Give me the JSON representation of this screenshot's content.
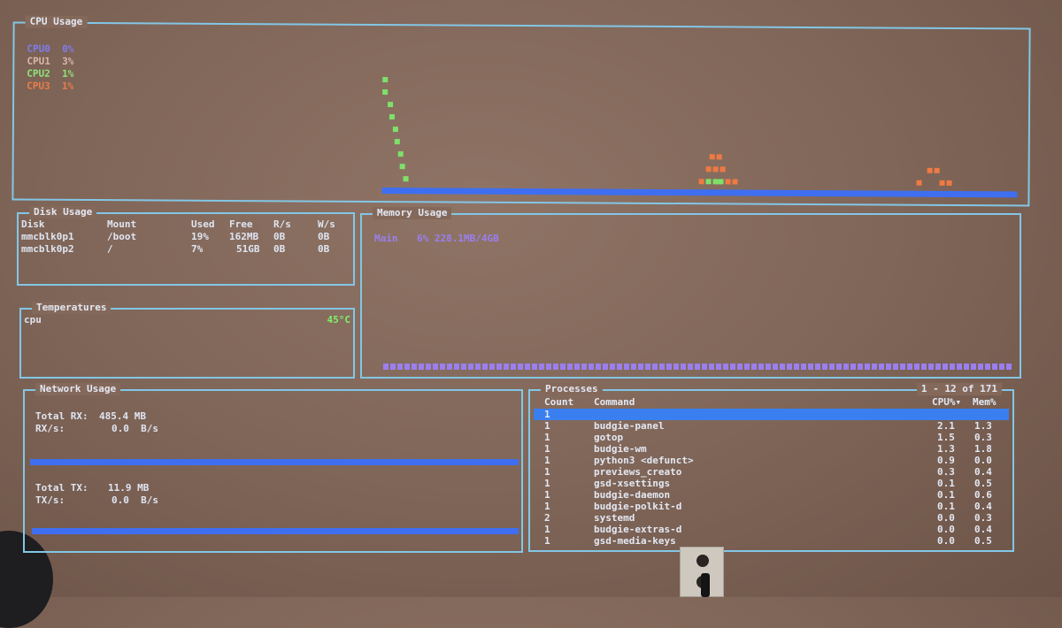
{
  "cpu": {
    "title": "CPU Usage",
    "legend": [
      {
        "name": "CPU0",
        "value": "0%",
        "color": "#7f7cf0"
      },
      {
        "name": "CPU1",
        "value": "3%",
        "color": "#d9b8a8"
      },
      {
        "name": "CPU2",
        "value": "1%",
        "color": "#8fe37a"
      },
      {
        "name": "CPU3",
        "value": "1%",
        "color": "#ea7c4b"
      }
    ],
    "colors": {
      "baseline": "#3f6ff0",
      "cpu2": "#7fe06a",
      "cpu3": "#ef7a43"
    }
  },
  "disk": {
    "title": "Disk Usage",
    "headers": [
      "Disk",
      "Mount",
      "Used",
      "Free",
      "R/s",
      "W/s"
    ],
    "rows": [
      [
        "mmcblk0p1",
        "/boot",
        "19%",
        "162MB",
        "0B",
        "0B"
      ],
      [
        "mmcblk0p2",
        "/",
        "7%",
        "51GB",
        "0B",
        "0B"
      ]
    ]
  },
  "memory": {
    "title": "Memory Usage",
    "label": "Main",
    "value": "6% 228.1MB/4GB",
    "color": "#9a7ff0"
  },
  "temps": {
    "title": "Temperatures",
    "sensor": "cpu",
    "value": "45°C",
    "value_color": "#7ff06a"
  },
  "network": {
    "title": "Network Usage",
    "rx_total_label": "Total RX:",
    "rx_total": "485.4 MB",
    "rx_rate_label": "RX/s:",
    "rx_rate": "0.0  B/s",
    "tx_total_label": "Total TX:",
    "tx_total": "11.9 MB",
    "tx_rate_label": "TX/s:",
    "tx_rate": "0.0  B/s"
  },
  "processes": {
    "title": "Processes",
    "range": "1 - 12 of 171",
    "headers": {
      "count": "Count",
      "command": "Command",
      "cpu": "CPU%▾",
      "mem": "Mem%"
    },
    "rows": [
      {
        "count": "1",
        "command": "",
        "cpu": "",
        "mem": "",
        "selected": true
      },
      {
        "count": "1",
        "command": "budgie-panel",
        "cpu": "2.1",
        "mem": "1.3"
      },
      {
        "count": "1",
        "command": "gotop",
        "cpu": "1.5",
        "mem": "0.3"
      },
      {
        "count": "1",
        "command": "budgie-wm",
        "cpu": "1.3",
        "mem": "1.8"
      },
      {
        "count": "1",
        "command": "python3 <defunct>",
        "cpu": "0.9",
        "mem": "0.0"
      },
      {
        "count": "1",
        "command": "previews_creato",
        "cpu": "0.3",
        "mem": "0.4"
      },
      {
        "count": "1",
        "command": "gsd-xsettings",
        "cpu": "0.1",
        "mem": "0.5"
      },
      {
        "count": "1",
        "command": "budgie-daemon",
        "cpu": "0.1",
        "mem": "0.6"
      },
      {
        "count": "1",
        "command": "budgie-polkit-d",
        "cpu": "0.1",
        "mem": "0.4"
      },
      {
        "count": "2",
        "command": "systemd",
        "cpu": "0.0",
        "mem": "0.3"
      },
      {
        "count": "1",
        "command": "budgie-extras-d",
        "cpu": "0.0",
        "mem": "0.4"
      },
      {
        "count": "1",
        "command": "gsd-media-keys",
        "cpu": "0.0",
        "mem": "0.5"
      }
    ]
  },
  "theme": {
    "border": "#83c6e6",
    "bar_blue": "#3f6ff0",
    "selected_row": "#3a7ff0"
  }
}
